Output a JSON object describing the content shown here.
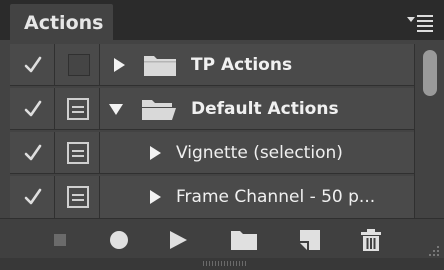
{
  "panel": {
    "title": "Actions",
    "menu_icon": "panel-menu-icon",
    "colors": {
      "background": "#434343",
      "header": "#2b2b2b",
      "row": "#4a4a4a",
      "text": "#f0f0f0"
    }
  },
  "actions": [
    {
      "label": "TP Actions",
      "enabled": true,
      "dialog_toggle": false,
      "expanded": false,
      "type": "set"
    },
    {
      "label": "Default Actions",
      "enabled": true,
      "dialog_toggle": true,
      "expanded": true,
      "type": "set"
    },
    {
      "label": "Vignette (selection)",
      "enabled": true,
      "dialog_toggle": true,
      "expanded": false,
      "type": "action"
    },
    {
      "label": "Frame Channel - 50 p...",
      "enabled": true,
      "dialog_toggle": true,
      "expanded": false,
      "type": "action"
    }
  ],
  "toolbar": {
    "buttons": [
      "stop-icon",
      "record-icon",
      "play-icon",
      "folder-icon",
      "new-action-icon",
      "trash-icon"
    ]
  }
}
